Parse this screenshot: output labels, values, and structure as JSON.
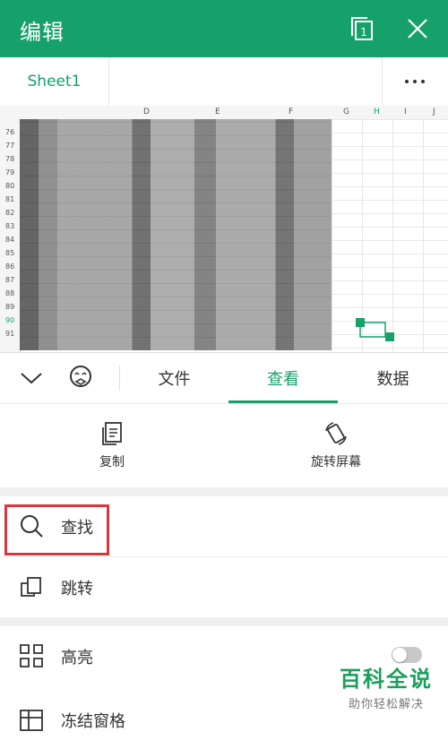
{
  "topbar": {
    "title": "编辑"
  },
  "sheet_tabs": [
    {
      "label": "Sheet1"
    }
  ],
  "columns": [
    "D",
    "E",
    "F",
    "G",
    "H",
    "I",
    "J"
  ],
  "rows": [
    "76",
    "77",
    "78",
    "79",
    "80",
    "81",
    "82",
    "83",
    "84",
    "85",
    "86",
    "87",
    "88",
    "89",
    "90",
    "91"
  ],
  "selected_cell": {
    "column": "H",
    "row": "90"
  },
  "colors": {
    "accent": "#16a06a",
    "highlight_box": "#d9373b"
  },
  "toolbar": {
    "tabs": [
      {
        "label": "文件"
      },
      {
        "label": "查看",
        "active": true
      },
      {
        "label": "数据"
      }
    ]
  },
  "actions": [
    {
      "label": "复制",
      "icon": "copy-icon"
    },
    {
      "label": "旋转屏幕",
      "icon": "rotate-screen-icon"
    }
  ],
  "menu": {
    "find": "查找",
    "jump": "跳转",
    "highlight": "高亮",
    "freeze": "冻结窗格"
  },
  "highlight_toggle": {
    "on": false
  },
  "watermark": {
    "title": "百科全说",
    "subtitle": "助你轻松解决"
  }
}
